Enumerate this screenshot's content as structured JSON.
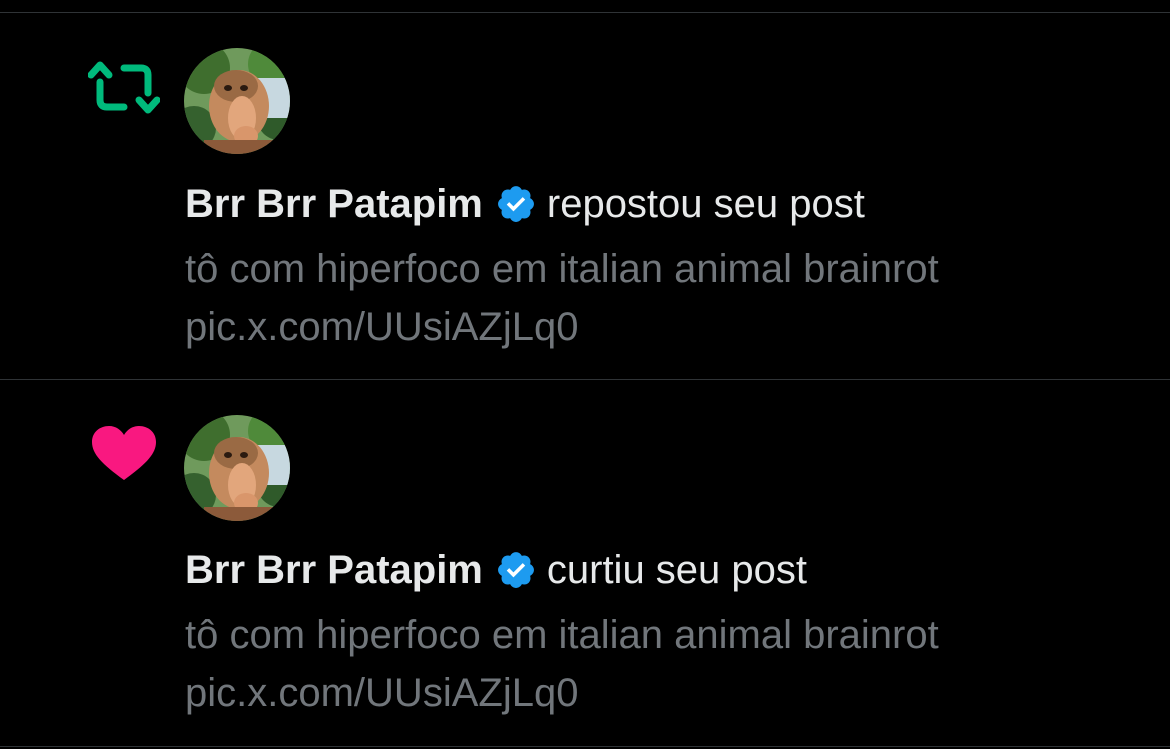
{
  "colors": {
    "background": "#000000",
    "divider": "#2f3336",
    "primary_text": "#e7e9ea",
    "secondary_text": "#71767b",
    "repost_green": "#00ba7c",
    "like_pink": "#f91880",
    "verified_blue": "#1d9bf0"
  },
  "notifications": [
    {
      "type": "repost",
      "icon": "repost-icon",
      "user_name": "Brr Brr Patapim",
      "verified": true,
      "action_text": "repostou seu post",
      "post_text": "tô com hiperfoco em italian animal brainrot",
      "post_link": "pic.x.com/UUsiAZjLq0"
    },
    {
      "type": "like",
      "icon": "heart-icon",
      "user_name": "Brr Brr Patapim",
      "verified": true,
      "action_text": "curtiu seu post",
      "post_text": "tô com hiperfoco em italian animal brainrot",
      "post_link": "pic.x.com/UUsiAZjLq0"
    }
  ]
}
